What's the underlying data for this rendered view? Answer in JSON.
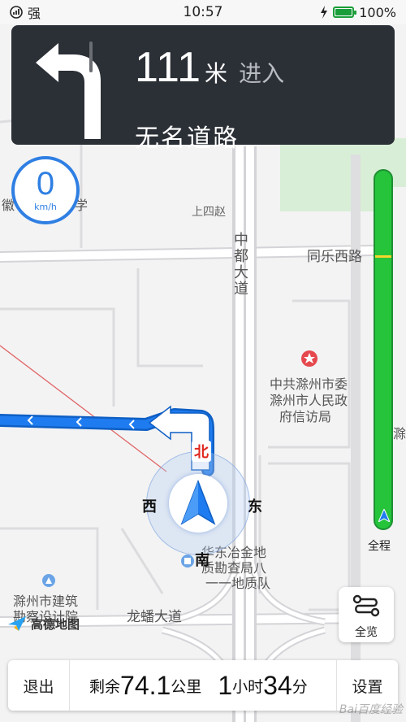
{
  "status_bar": {
    "signal_text": "强",
    "time": "10:57",
    "battery_text": "100%"
  },
  "guidance": {
    "distance_value": "111",
    "distance_unit": "米",
    "action": "进入",
    "road_name": "无名道路",
    "turn_icon": "turn-left-arrow"
  },
  "speed": {
    "value": "0",
    "unit": "km/h"
  },
  "map": {
    "labels": {
      "shangsizhao": "上四赵",
      "zhongdu_road": "中都大道",
      "tongle_west_road": "同乐西路",
      "party_committee_1": "中共滁州市委",
      "party_committee_2": "滁州市人民政",
      "party_committee_3": "府信访局",
      "survey_1": "华东冶金地",
      "survey_2": "质勘查局八",
      "survey_3": "一一地质队",
      "design_1": "滁州市建筑",
      "design_2": "勘察设计院",
      "longpan_road": "龙蟠大道",
      "edge_left_school": "徽",
      "edge_left_xue": "学",
      "edge_right_chu": "滁"
    },
    "compass": {
      "north": "北",
      "south": "南",
      "east": "东",
      "west": "西"
    },
    "colors": {
      "route": "#1e7cf0",
      "route_border": "#0f5fc4",
      "traffic_clear": "#25c43b",
      "traffic_slow": "#f4d62c",
      "landmark_red": "#e5484d"
    }
  },
  "traffic_bar": {
    "label": "全程"
  },
  "overview_button": {
    "label": "全览",
    "icon": "route-overview-icon"
  },
  "logo": {
    "text": "高德地图"
  },
  "bottom_bar": {
    "exit_label": "退出",
    "remain_prefix": "剩余",
    "remain_distance": "74.1",
    "remain_distance_unit": "公里",
    "time_hours": "1",
    "time_hours_unit": "小时",
    "time_minutes": "34",
    "time_minutes_unit": "分",
    "settings_label": "设置"
  },
  "watermark": "Bai百度经验"
}
